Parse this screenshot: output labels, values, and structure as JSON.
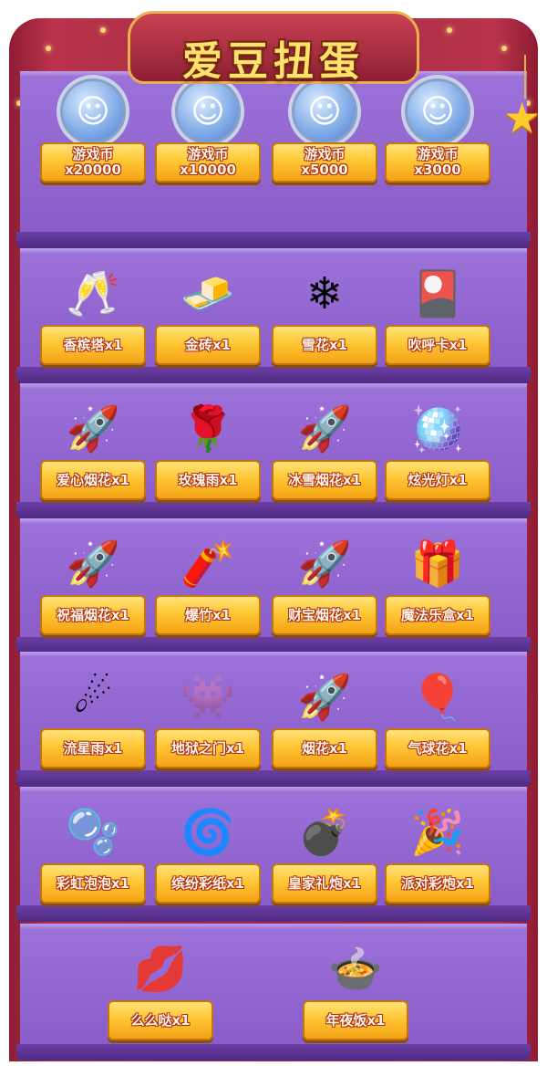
{
  "title": "爱豆扭蛋",
  "rows": [
    [
      {
        "l1": "游戏币",
        "l2": "x20000",
        "icon": "game-coin-icon",
        "glyph": "☺"
      },
      {
        "l1": "游戏币",
        "l2": "x10000",
        "icon": "game-coin-icon",
        "glyph": "☺"
      },
      {
        "l1": "游戏币",
        "l2": "x5000",
        "icon": "game-coin-icon",
        "glyph": "☺"
      },
      {
        "l1": "游戏币",
        "l2": "x3000",
        "icon": "game-coin-icon",
        "glyph": "☺"
      }
    ],
    [
      {
        "l1": "香槟塔x1",
        "icon": "champagne-tower-icon",
        "glyph": "🥂"
      },
      {
        "l1": "金砖x1",
        "icon": "gold-bar-icon",
        "glyph": "🧈"
      },
      {
        "l1": "雪花x1",
        "icon": "snowflake-icon",
        "glyph": "❄"
      },
      {
        "l1": "吹呼卡x1",
        "icon": "cheer-card-icon",
        "glyph": "🎴"
      }
    ],
    [
      {
        "l1": "爱心烟花x1",
        "icon": "love-firework-icon",
        "glyph": "🚀"
      },
      {
        "l1": "玫瑰雨x1",
        "icon": "rose-rain-icon",
        "glyph": "🌹"
      },
      {
        "l1": "冰雪烟花x1",
        "icon": "ice-firework-icon",
        "glyph": "🚀"
      },
      {
        "l1": "炫光灯x1",
        "icon": "disco-ball-icon",
        "glyph": "🪩"
      }
    ],
    [
      {
        "l1": "祝福烟花x1",
        "icon": "blessing-firework-icon",
        "glyph": "🚀"
      },
      {
        "l1": "爆竹x1",
        "icon": "firecracker-icon",
        "glyph": "🧨"
      },
      {
        "l1": "财宝烟花x1",
        "icon": "treasure-firework-icon",
        "glyph": "🚀"
      },
      {
        "l1": "魔法乐盒x1",
        "icon": "magic-music-box-icon",
        "glyph": "🎁"
      }
    ],
    [
      {
        "l1": "流星雨x1",
        "icon": "meteor-shower-icon",
        "glyph": "☄"
      },
      {
        "l1": "地狱之门x1",
        "icon": "hell-gate-monster-icon",
        "glyph": "👾"
      },
      {
        "l1": "烟花x1",
        "icon": "firework-icon",
        "glyph": "🚀"
      },
      {
        "l1": "气球花x1",
        "icon": "balloon-bouquet-icon",
        "glyph": "🎈"
      }
    ],
    [
      {
        "l1": "彩虹泡泡x1",
        "icon": "rainbow-bubbles-icon",
        "glyph": "🫧"
      },
      {
        "l1": "缤纷彩纸x1",
        "icon": "confetti-swirl-icon",
        "glyph": "🌀"
      },
      {
        "l1": "皇家礼炮x1",
        "icon": "royal-cannon-icon",
        "glyph": "💣"
      },
      {
        "l1": "派对彩炮x1",
        "icon": "party-popper-icon",
        "glyph": "🎉"
      }
    ],
    [
      {
        "l1": "么么哒x1",
        "icon": "kiss-lips-icon",
        "glyph": "💋"
      },
      {
        "l1": "年夜饭x1",
        "icon": "new-year-dinner-icon",
        "glyph": "🍲"
      }
    ]
  ]
}
